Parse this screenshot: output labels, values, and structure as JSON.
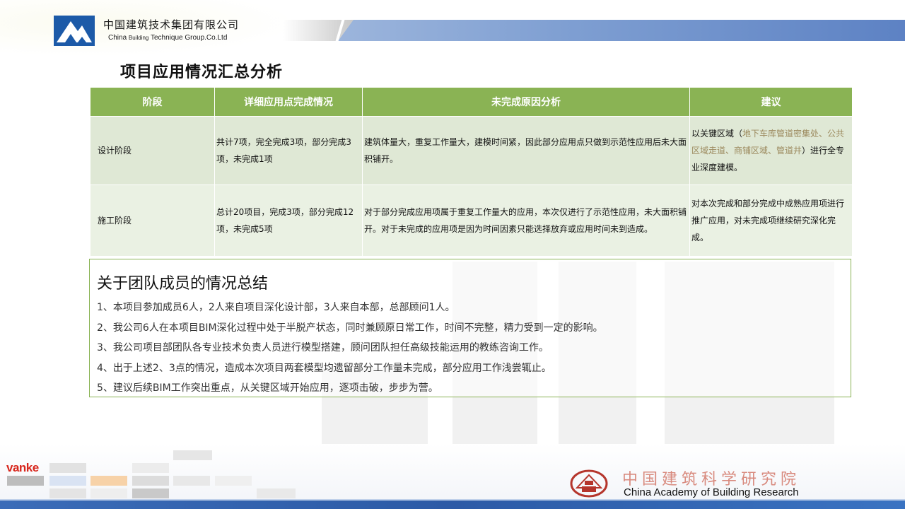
{
  "header": {
    "company_cn": "中国建筑技术集团有限公司",
    "company_en_a": "China ",
    "company_en_small": "Building",
    "company_en_b": " Technique Group.Co.Ltd"
  },
  "page_title": "项目应用情况汇总分析",
  "table": {
    "headers": [
      "阶段",
      "详细应用点完成情况",
      "未完成原因分析",
      "建议"
    ],
    "rows": [
      {
        "stage": "设计阶段",
        "completion": "共计7项，完全完成3项，部分完成3项，未完成1项",
        "reason": "建筑体量大，重复工作量大，建模时间紧，因此部分应用点只做到示范性应用后未大面积铺开。",
        "advice_a": "以关键区域（",
        "advice_highlight": "地下车库管道密集处、公共区域走道、商铺区域、管道井",
        "advice_b": "）进行全专业深度建模。"
      },
      {
        "stage": "施工阶段",
        "completion": "总计20项目，完成3项，部分完成12项，未完成5项",
        "reason": "对于部分完成应用项属于重复工作量大的应用，本次仅进行了示范性应用，未大面积铺开。对于未完成的应用项是因为时间因素只能选择放弃或应用时间未到造成。",
        "advice": "对本次完成和部分完成中成熟应用项进行推广应用，对未完成项继续研究深化完成。"
      }
    ]
  },
  "summary": {
    "title": "关于团队成员的情况总结",
    "items": [
      "1、本项目参加成员6人，2人来自项目深化设计部，3人来自本部，总部顾问1人。",
      "2、我公司6人在本项目BIM深化过程中处于半脱产状态，同时兼顾原日常工作，时间不完整，精力受到一定的影响。",
      "3、我公司项目部团队各专业技术负责人员进行模型搭建，顾问团队担任高级技能运用的教练咨询工作。",
      "4、出于上述2、3点的情况，造成本次项目两套模型均遗留部分工作量未完成，部分应用工作浅尝辄止。",
      "5、建议后续BIM工作突出重点，从关键区域开始应用，逐项击破，步步为营。"
    ]
  },
  "footer": {
    "vanke": "vanke",
    "cabr_cn": "中国建筑科学研究院",
    "cabr_en": "China Academy of Building Research"
  },
  "colors": {
    "header_green": "#8ab354",
    "row1_bg": "#dfe8d5",
    "row2_bg": "#eaf1e3",
    "highlight_brown": "#9c8a5e",
    "brand_blue": "#1c5aa8",
    "vanke_red": "#d8261c"
  }
}
